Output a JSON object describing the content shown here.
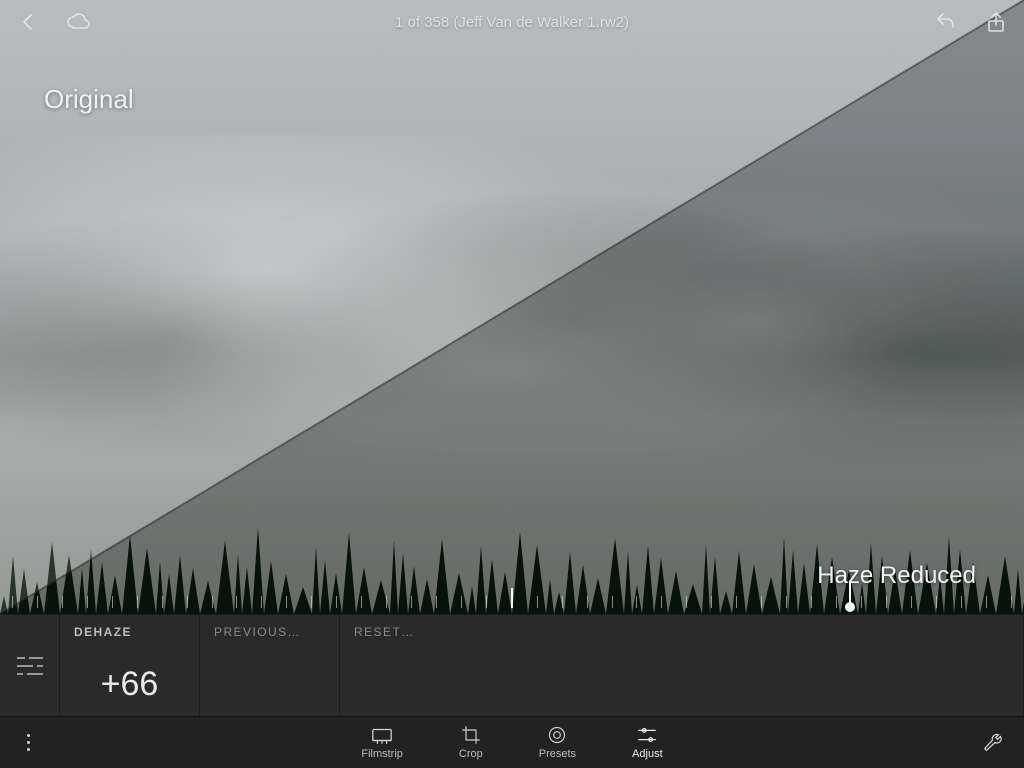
{
  "header": {
    "title": "1 of 358 (Jeff Van de Walker 1.rw2)"
  },
  "overlay": {
    "original_label": "Original",
    "reduced_label": "Haze Reduced"
  },
  "ruler": {
    "tick_count": 41,
    "center_index": 20,
    "knob_position_pct": 83
  },
  "adjust_panel": {
    "active": {
      "name": "DEHAZE",
      "value": "+66"
    },
    "previous_label": "PREVIOUS…",
    "reset_label": "RESET…"
  },
  "toolbar": {
    "items": [
      {
        "id": "filmstrip",
        "label": "Filmstrip"
      },
      {
        "id": "crop",
        "label": "Crop"
      },
      {
        "id": "presets",
        "label": "Presets"
      },
      {
        "id": "adjust",
        "label": "Adjust"
      }
    ],
    "active_id": "adjust"
  },
  "colors": {
    "panel_bg": "#2a2a2a",
    "toolbar_bg": "#222222"
  }
}
